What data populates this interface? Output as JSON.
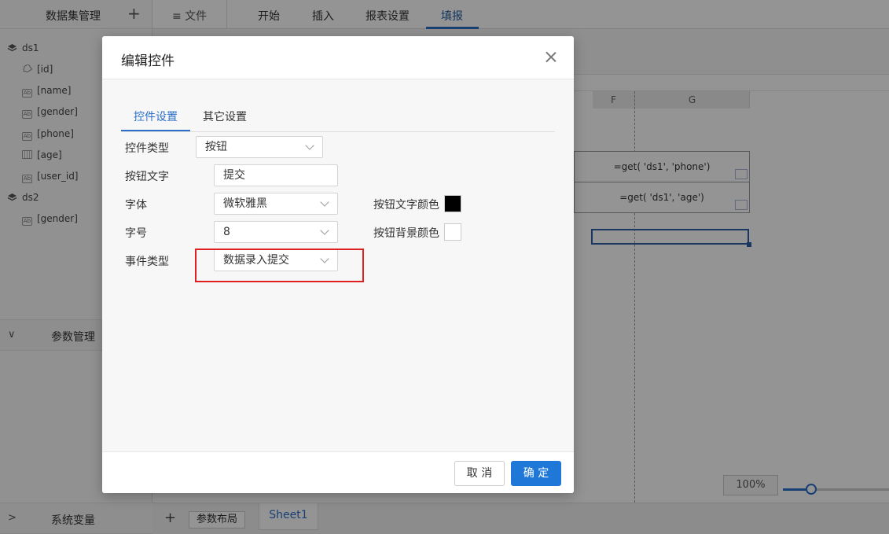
{
  "sidebar": {
    "title": "数据集管理",
    "add_symbol": "+",
    "tree": [
      {
        "label": "ds1",
        "icon": "layers-icon"
      },
      {
        "label": "[id]",
        "icon": "tag-icon"
      },
      {
        "label": "[name]",
        "icon": "text-field-icon"
      },
      {
        "label": "[gender]",
        "icon": "text-field-icon"
      },
      {
        "label": "[phone]",
        "icon": "text-field-icon"
      },
      {
        "label": "[age]",
        "icon": "calendar-icon"
      },
      {
        "label": "[user_id]",
        "icon": "text-field-icon"
      },
      {
        "label": "ds2",
        "icon": "layers-icon"
      },
      {
        "label": "[gender]",
        "icon": "text-field-icon"
      }
    ],
    "param_section": {
      "label": "参数管理",
      "chevron": "∨"
    },
    "sysvar_section": {
      "label": "系统变量",
      "chevron": ">"
    }
  },
  "topbar": {
    "file_menu": "≡ 文件",
    "tabs": [
      "开始",
      "插入",
      "报表设置",
      "填报"
    ],
    "active_tab": "填报"
  },
  "grid": {
    "columns": [
      "F",
      "G"
    ],
    "cells": [
      "=get( 'ds1', 'phone')",
      "=get( 'ds1', 'age')"
    ]
  },
  "zoom": {
    "label": "100%",
    "level": 0.25
  },
  "bottombar": {
    "add_symbol": "+",
    "layout_button": "参数布局",
    "sheet_tab": "Sheet1"
  },
  "dialog": {
    "title": "编辑控件",
    "tabs": [
      "控件设置",
      "其它设置"
    ],
    "active_tab": "控件设置",
    "fields": {
      "control_type": {
        "label": "控件类型",
        "value": "按钮"
      },
      "button_text": {
        "label": "按钮文字",
        "value": "提交"
      },
      "font": {
        "label": "字体",
        "value": "微软雅黑"
      },
      "font_size": {
        "label": "字号",
        "value": "8"
      },
      "event_type": {
        "label": "事件类型",
        "value": "数据录入提交"
      },
      "text_color": {
        "label": "按钮文字颜色",
        "color": "#000000"
      },
      "bg_color": {
        "label": "按钮背景颜色",
        "color": "#ffffff"
      }
    },
    "buttons": {
      "cancel": "取 消",
      "ok": "确 定"
    }
  },
  "colors": {
    "accent": "#2b6fc9",
    "primary_button": "#1f78d8",
    "highlight_box": "#e02020"
  }
}
